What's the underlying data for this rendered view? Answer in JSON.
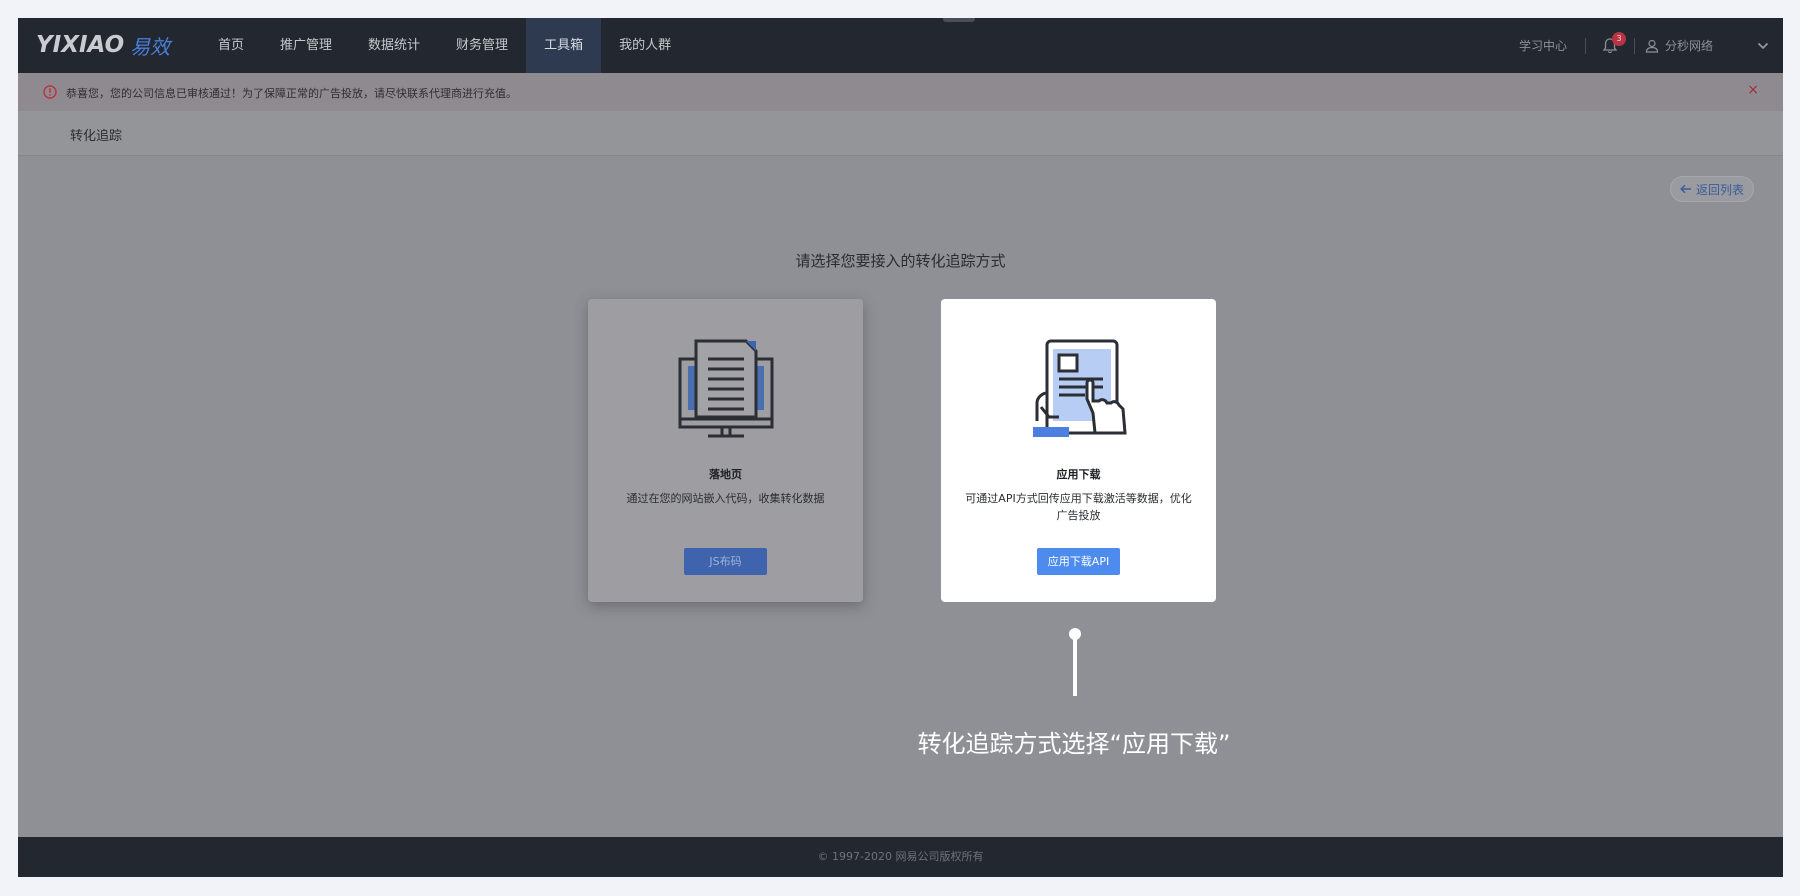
{
  "header": {
    "logo_text": "YIXIAO",
    "logo_cn": "易效",
    "nav": [
      {
        "label": "首页"
      },
      {
        "label": "推广管理"
      },
      {
        "label": "数据统计"
      },
      {
        "label": "财务管理"
      },
      {
        "label": "工具箱",
        "active": true
      },
      {
        "label": "我的人群"
      }
    ],
    "learn_center": "学习中心",
    "notification_count": "3",
    "username": "分秒网络"
  },
  "alert": {
    "text": "恭喜您，您的公司信息已审核通过！为了保障正常的广告投放，请尽快联系代理商进行充值。",
    "close_glyph": "×"
  },
  "breadcrumb": {
    "label": "转化追踪"
  },
  "back_button": {
    "label": "返回列表"
  },
  "prompt": "请选择您要接入的转化追踪方式",
  "cards": [
    {
      "title": "落地页",
      "description": "通过在您的网站嵌入代码，收集转化数据",
      "button": "JS布码"
    },
    {
      "title": "应用下载",
      "description": "可通过API方式回传应用下载激活等数据，优化广告投放",
      "button": "应用下载API"
    }
  ],
  "annotation": "转化追踪方式选择“应用下载”",
  "footer": "© 1997-2020 网易公司版权所有",
  "colors": {
    "nav_bg": "#23272f",
    "accent": "#4d8cee",
    "alert_icon": "#b83343"
  }
}
